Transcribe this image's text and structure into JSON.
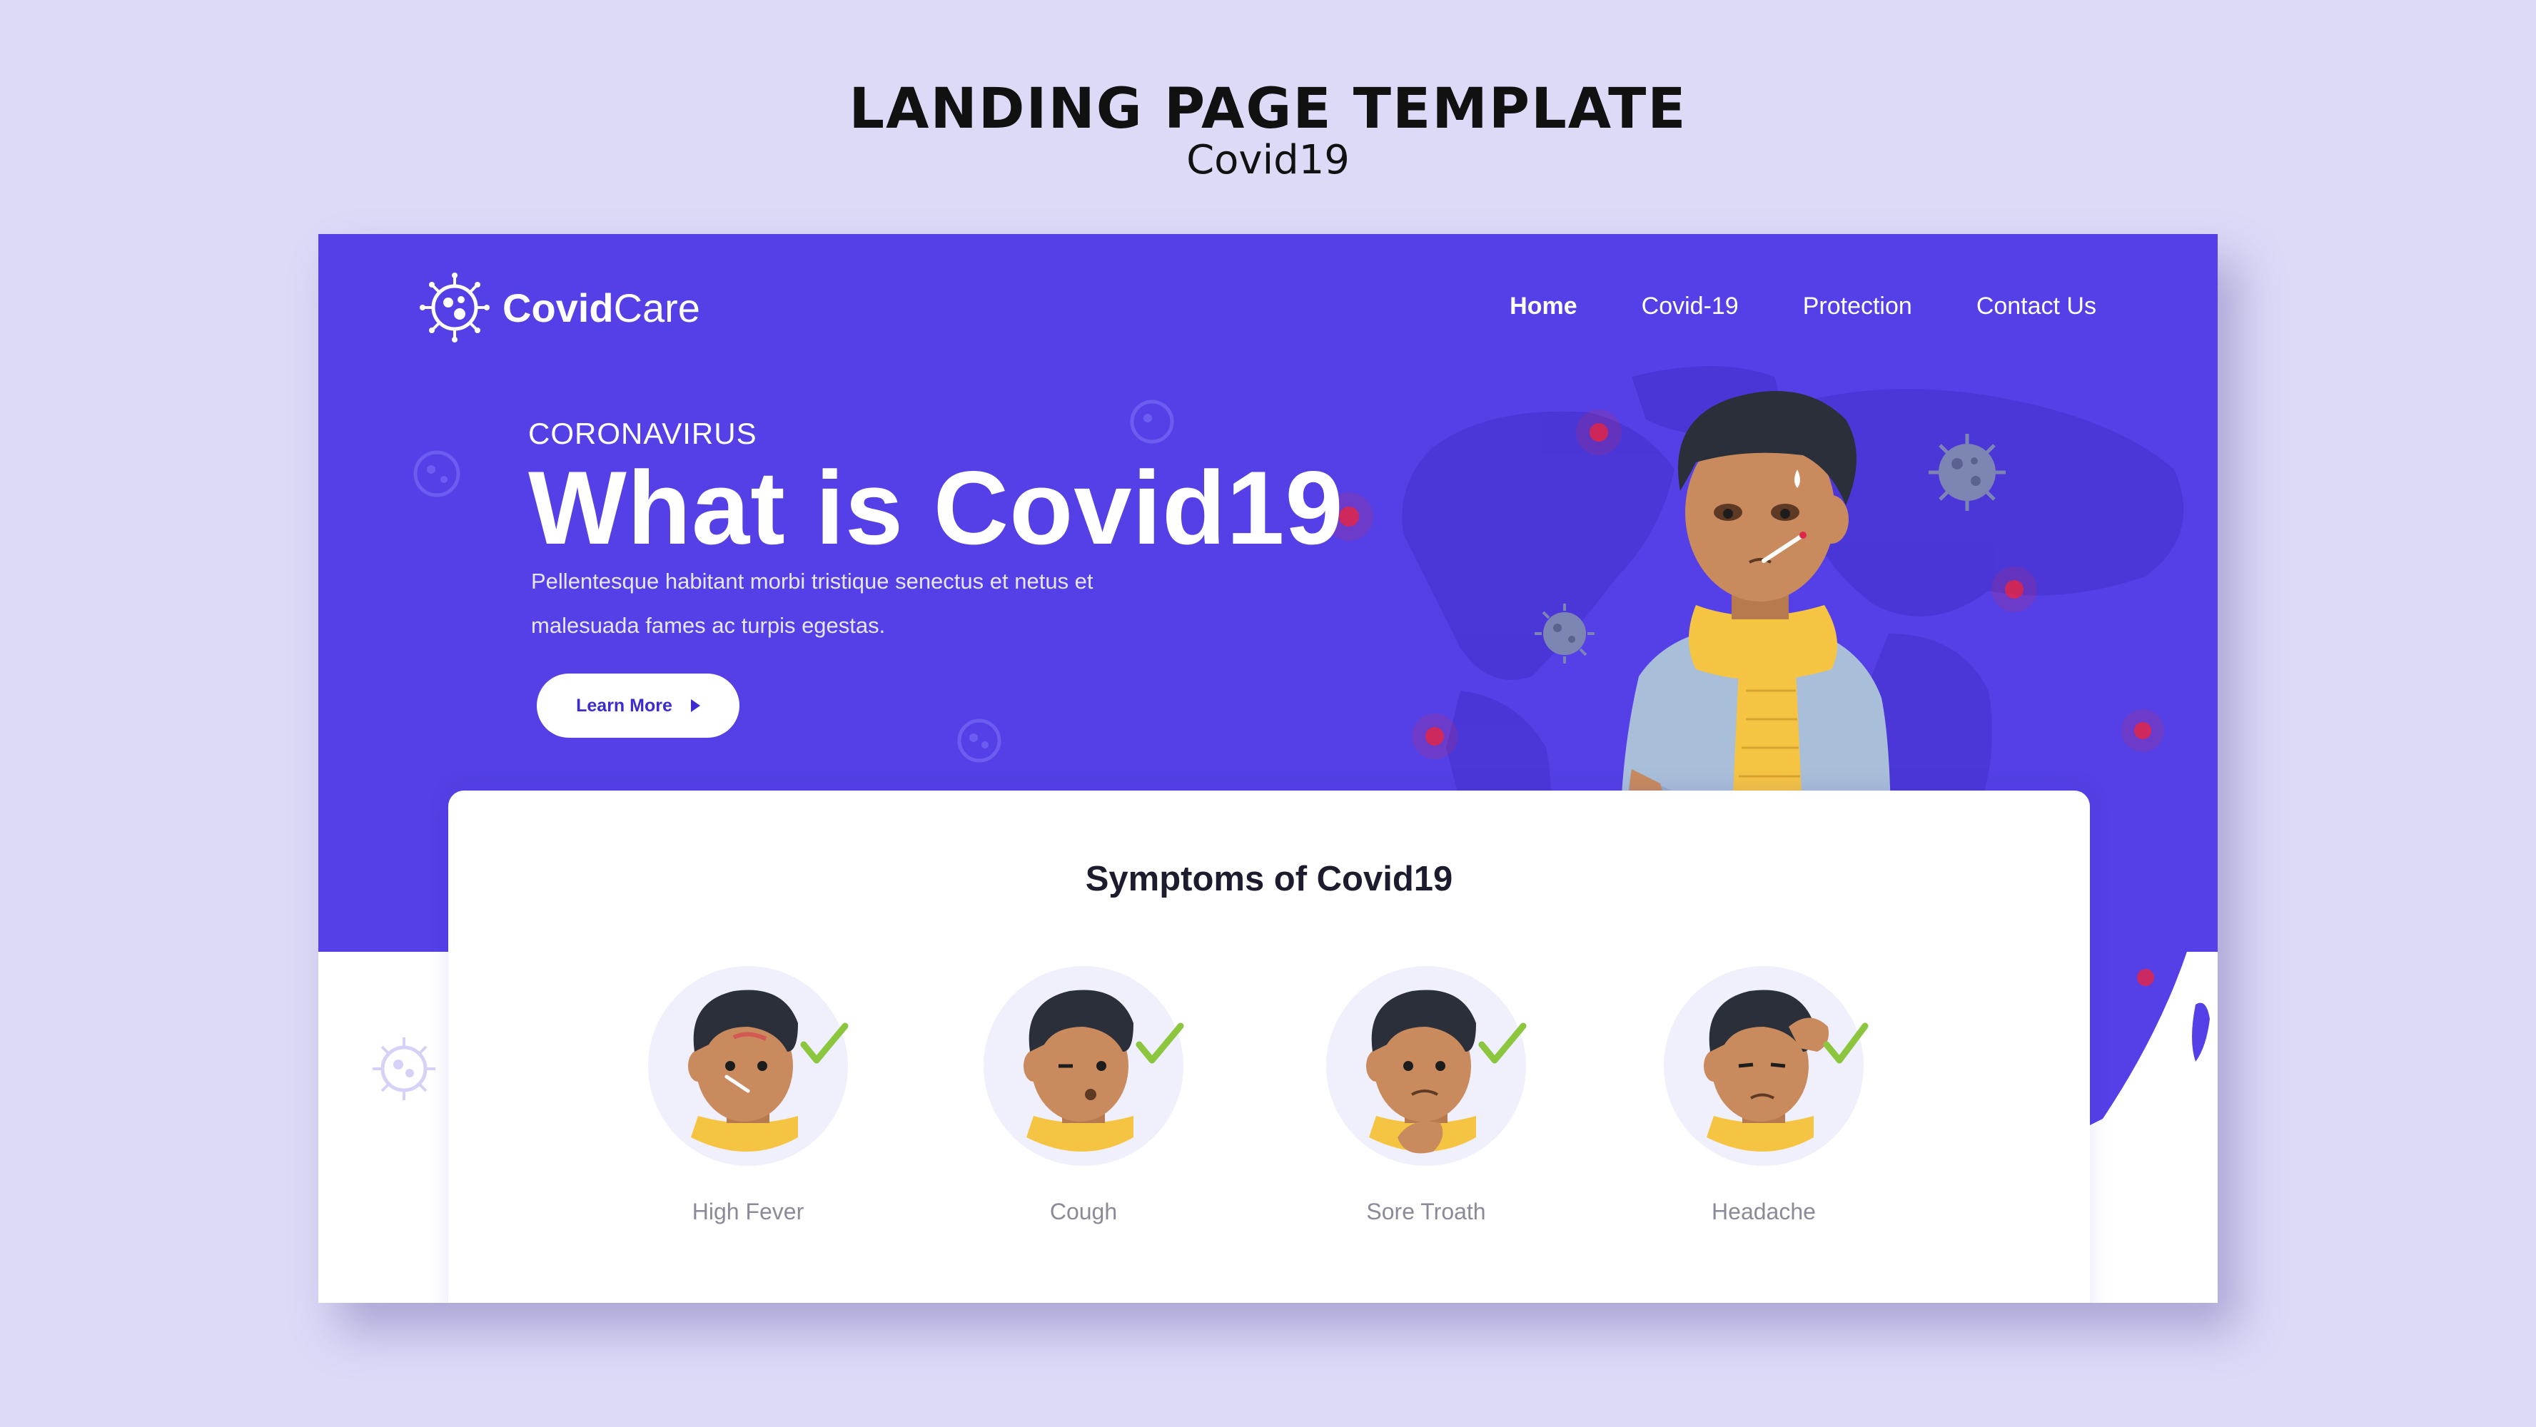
{
  "presentation": {
    "title": "LANDING PAGE TEMPLATE",
    "subtitle": "Covid19"
  },
  "brand": {
    "name_bold": "Covid",
    "name_light": "Care",
    "icon": "virus-icon"
  },
  "nav": {
    "items": [
      {
        "label": "Home",
        "active": true
      },
      {
        "label": "Covid-19",
        "active": false
      },
      {
        "label": "Protection",
        "active": false
      },
      {
        "label": "Contact Us",
        "active": false
      }
    ]
  },
  "hero": {
    "eyebrow": "CORONAVIRUS",
    "headline": "What is Covid19",
    "lead_line1": "Pellentesque habitant morbi tristique senectus et netus et",
    "lead_line2": "malesuada fames ac turpis egestas.",
    "cta_label": "Learn More",
    "cta_icon": "play-arrow-icon"
  },
  "symptoms": {
    "title": "Symptoms of Covid19",
    "items": [
      {
        "label": "High Fever",
        "icon": "fever-face-icon"
      },
      {
        "label": "Cough",
        "icon": "cough-face-icon"
      },
      {
        "label": "Sore Troath",
        "icon": "sore-throat-face-icon"
      },
      {
        "label": "Headache",
        "icon": "headache-face-icon"
      }
    ]
  },
  "colors": {
    "page_bg": "#dcdaf7",
    "brand_purple": "#5440e6",
    "scarf_yellow": "#f6c443",
    "check_green": "#8cc63f",
    "hot_spot_red": "#e0264a"
  }
}
